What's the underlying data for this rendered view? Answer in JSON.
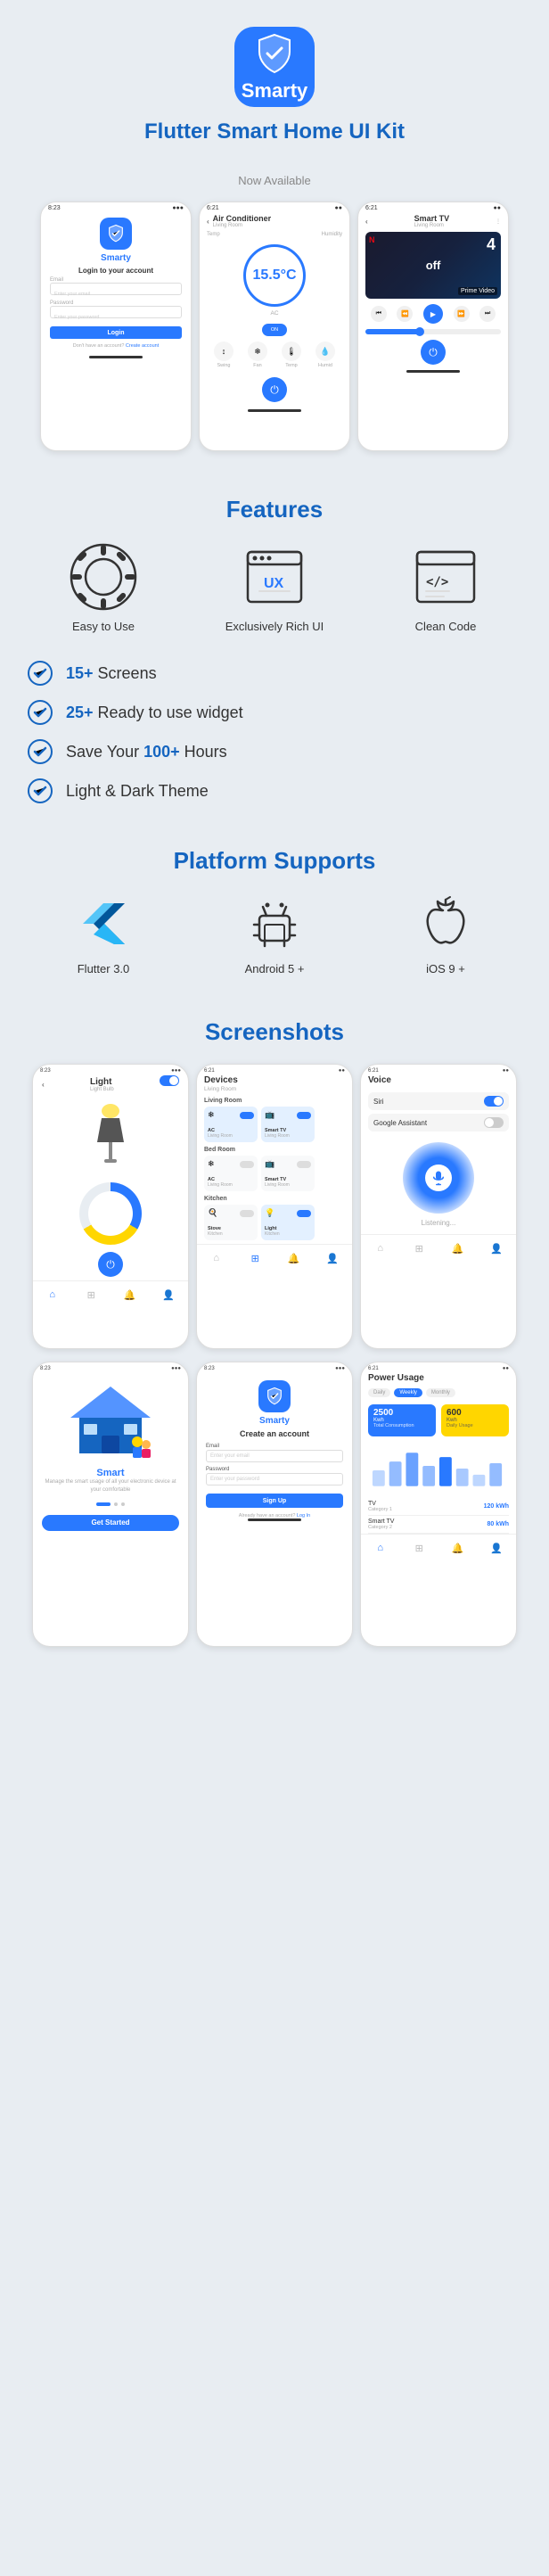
{
  "logo": {
    "icon_alt": "smarty-shield-icon",
    "brand_name": "Smarty",
    "app_title": "Flutter Smart Home UI Kit"
  },
  "now_available": "Now Available",
  "screens": {
    "login": {
      "brand": "Smarty",
      "title": "Login to your account",
      "email_label": "Email",
      "email_placeholder": "Enter your email",
      "password_label": "Password",
      "password_placeholder": "Enter your password",
      "btn_label": "Login",
      "footer": "Don't have an account? Create account"
    },
    "ac": {
      "title": "Air Conditioner",
      "room": "Living Room",
      "label": "AC",
      "temp": "15.5°C",
      "controls": [
        "Swing",
        "Fan",
        "Temp",
        "Humidity"
      ]
    },
    "tv": {
      "title": "Smart TV",
      "room": "Living Room",
      "netflix": "N",
      "off_text": "off"
    }
  },
  "features": {
    "title": "Features",
    "items": [
      {
        "label": "Easy to Use",
        "icon": "gear"
      },
      {
        "label": "Exclusively Rich UI",
        "icon": "ux"
      },
      {
        "label": "Clean Code",
        "icon": "code"
      }
    ]
  },
  "checklist": {
    "items": [
      {
        "pre": "",
        "highlight": "15+",
        "post": " Screens"
      },
      {
        "pre": "",
        "highlight": "25+",
        "post": " Ready to use widget"
      },
      {
        "pre": "Save Your ",
        "highlight": "100+",
        "post": " Hours"
      },
      {
        "pre": "",
        "highlight": "",
        "post": "Light & Dark Theme"
      }
    ]
  },
  "platform": {
    "title": "Platform Supports",
    "items": [
      {
        "label": "Flutter 3.0",
        "icon": "flutter"
      },
      {
        "label": "Android 5 +",
        "icon": "android"
      },
      {
        "label": "iOS 9 +",
        "icon": "apple"
      }
    ]
  },
  "screenshots_title": "Screenshots",
  "screenshots_row1": {
    "light": {
      "title": "Light",
      "subtitle": "Light Bulb",
      "on": true
    },
    "devices": {
      "title": "Devices",
      "subtitle": "Living Room",
      "sections": [
        "Living Room",
        "Bed Room",
        "Kitchen"
      ]
    },
    "voice": {
      "title": "Voice",
      "siri": "Siri",
      "google": "Google Assistant",
      "listening": "Listening..."
    }
  },
  "screenshots_row2": {
    "smart": {
      "brand": "Smart",
      "tagline": "Manage the smart usage of all your electronic device at your comfortable"
    },
    "register": {
      "brand": "Smarty",
      "title": "Create an account",
      "email_label": "Email",
      "email_placeholder": "Enter your email",
      "password_label": "Password",
      "password_placeholder": "Enter your password",
      "btn_label": "Sign Up",
      "footer": "Already have an account? Log In"
    },
    "power": {
      "title": "Power Usage",
      "tabs": [
        "Daily",
        "Weekly",
        "Monthly"
      ],
      "active_tab": "Weekly",
      "stat1_value": "2500",
      "stat1_unit": "Kwh",
      "stat1_label": "Total Consumption",
      "stat2_value": "600",
      "stat2_unit": "Kwh",
      "stat2_label": "Daily Usage",
      "devices": [
        {
          "name": "TV",
          "loc": "Category 1",
          "val": "120 kWh"
        },
        {
          "name": "Smart TV",
          "loc": "Category 2",
          "val": "80 kWh"
        }
      ]
    }
  }
}
